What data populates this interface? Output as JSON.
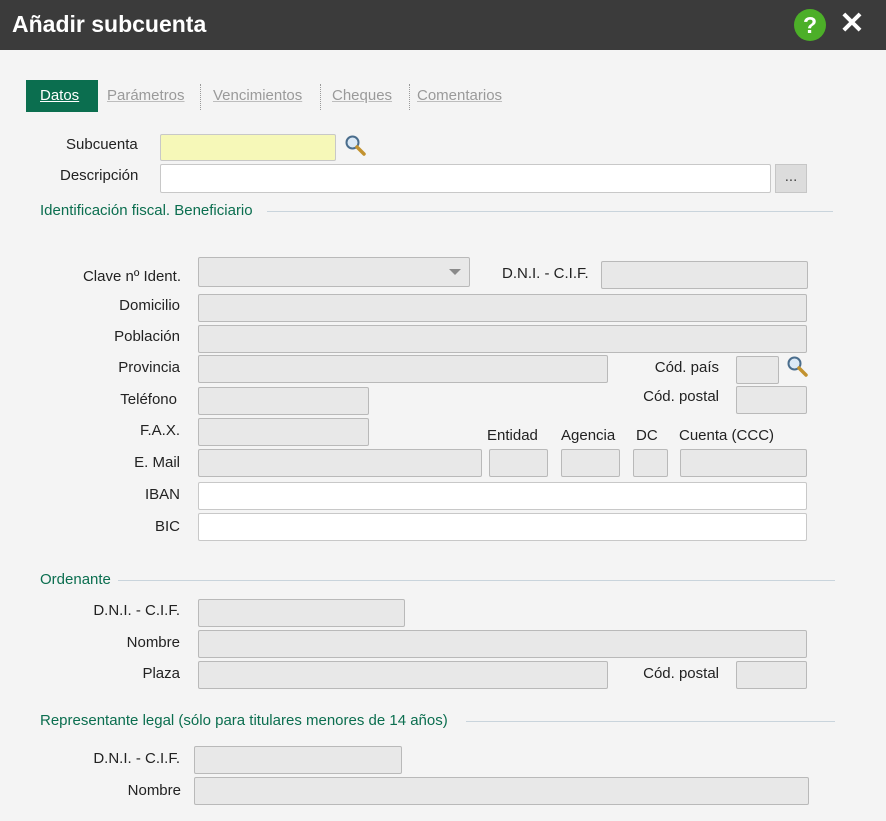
{
  "window": {
    "title": "Añadir subcuenta",
    "help_label": "?",
    "close_label": "✕"
  },
  "tabs": [
    {
      "label": "Datos",
      "active": true
    },
    {
      "label": "Parámetros",
      "active": false
    },
    {
      "label": "Vencimientos",
      "active": false
    },
    {
      "label": "Cheques",
      "active": false
    },
    {
      "label": "Comentarios",
      "active": false
    }
  ],
  "header": {
    "subcuenta_label": "Subcuenta",
    "subcuenta_value": "",
    "descripcion_label": "Descripción",
    "descripcion_value": "",
    "dots_label": "..."
  },
  "identificacion": {
    "section_title": "Identificación fiscal. Beneficiario",
    "clave_label": "Clave nº Ident.",
    "clave_value": "",
    "dni_label": "D.N.I. - C.I.F.",
    "domicilio_label": "Domicilio",
    "poblacion_label": "Población",
    "provincia_label": "Provincia",
    "cod_pais_label": "Cód. país",
    "telefono_label": "Teléfono",
    "cod_postal_label": "Cód. postal",
    "fax_label": "F.A.X.",
    "email_label": "E. Mail",
    "entidad_label": "Entidad",
    "agencia_label": "Agencia",
    "dc_label": "DC",
    "cuenta_label": "Cuenta (CCC)",
    "iban_label": "IBAN",
    "bic_label": "BIC"
  },
  "ordenante": {
    "section_title": "Ordenante",
    "dni_label": "D.N.I. - C.I.F.",
    "nombre_label": "Nombre",
    "plaza_label": "Plaza",
    "cod_postal_label": "Cód. postal"
  },
  "representante": {
    "section_title": "Representante legal (sólo para titulares menores de 14 años)",
    "dni_label": "D.N.I. - C.I.F.",
    "nombre_label": "Nombre"
  },
  "colors": {
    "titlebar": "#3b3b3b",
    "accent_green": "#0b6e4f",
    "help_green": "#4caf28",
    "required_field": "#f6f8b8"
  },
  "icons": {
    "help": "help-icon",
    "close": "close-icon",
    "search": "search-icon"
  }
}
